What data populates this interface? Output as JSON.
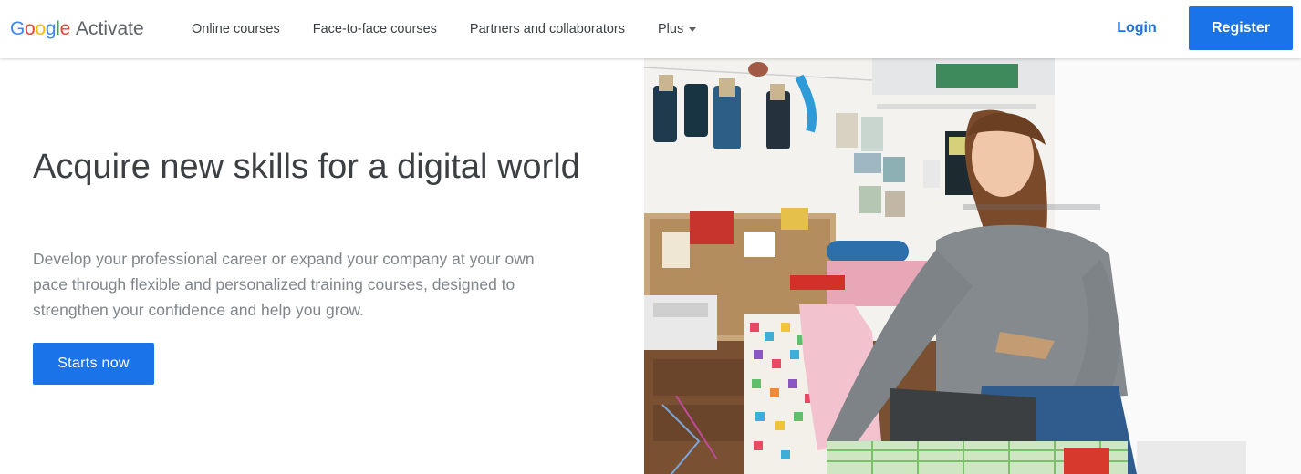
{
  "header": {
    "logo": {
      "google": "Google",
      "product": "Activate"
    },
    "nav": [
      {
        "label": "Online courses"
      },
      {
        "label": "Face-to-face courses"
      },
      {
        "label": "Partners and collaborators"
      },
      {
        "label": "Plus"
      }
    ],
    "login_label": "Login",
    "register_label": "Register"
  },
  "hero": {
    "title": "Acquire new skills for a digital world",
    "description": "Develop your professional career or expand your company at your own pace through flexible and personalized training courses, designed to strengthen your confidence and help you grow.",
    "cta_label": "Starts now"
  },
  "colors": {
    "accent": "#1a73e8",
    "title_text": "#3c4043",
    "body_text": "#80868b",
    "google_blue": "#4285f4",
    "google_red": "#ea4335",
    "google_yellow": "#fbbc05",
    "google_green": "#34a853"
  }
}
